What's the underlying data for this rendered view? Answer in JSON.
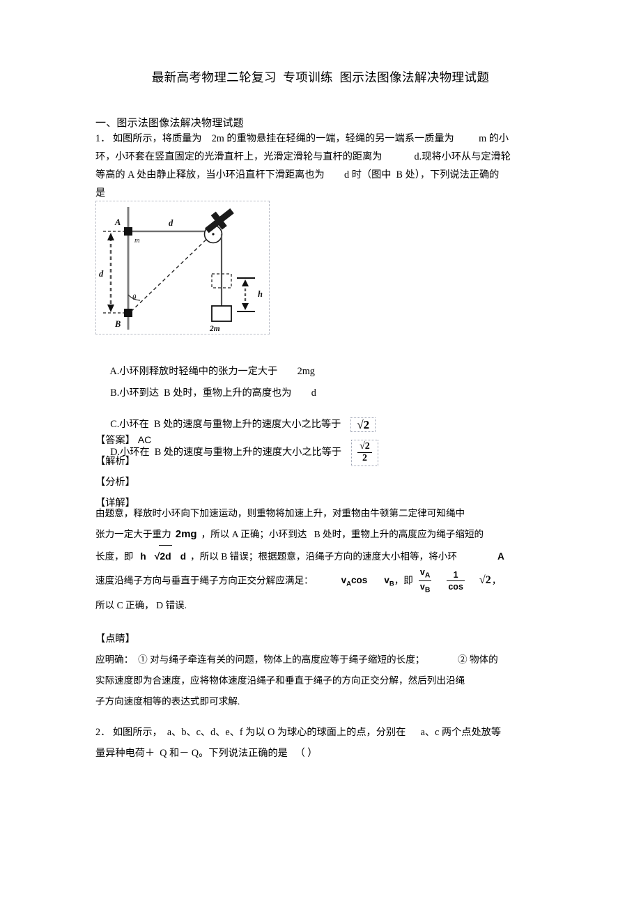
{
  "document": {
    "title": "最新高考物理二轮复习  专项训练  图示法图像法解决物理试题",
    "section_heading": "一、图示法图像法解决物理试题"
  },
  "question1": {
    "line1": "1． 如图所示，将质量为    2m 的重物悬挂在轻绳的一端，轻绳的另一端系一质量为          m 的小",
    "line2": "环，小环套在竖直固定的光滑直杆上，光滑定滑轮与直杆的距离为             d.现将小环从与定滑轮",
    "line3": "等高的 A 处由静止释放，当小环沿直杆下滑距离也为        d 时（图中  B 处），下列说法正确的",
    "line4": "是",
    "figure": {
      "label_A": "A",
      "label_B": "B",
      "label_m": "m",
      "label_2m": "2m",
      "label_d_horizontal": "d",
      "label_d_vertical": "d",
      "label_h": "h",
      "label_theta": "θ"
    },
    "options": [
      {
        "key": "A.",
        "text": "小环刚释放时轻绳中的张力一定大于        2mg"
      },
      {
        "key": "B.",
        "text": "小环到达  B 处时，重物上升的高度也为        d"
      },
      {
        "key": "C.",
        "text": "小环在  B 处的速度与重物上升的速度大小之比等于",
        "formula": "√2"
      },
      {
        "key": "D.",
        "text": "小环在  B 处的速度与重物上升的速度大小之比等于",
        "formula_num": "√2",
        "formula_den": "2"
      }
    ],
    "answer_label": "【答案】",
    "answer_value": "AC",
    "analysis_label": "【解析】",
    "fenxi_label": "【分析】",
    "xiangjie_label": "【详解】",
    "detail_line1": "由题意，释放时小环向下加速运动，则重物将加速上升，对重物由牛顿第二定律可知绳中",
    "detail_line2_a": "张力一定大于重力",
    "detail_line2_b": "2mg",
    "detail_line2_c": "，所以 A 正确；小环到达   B 处时，重物上升的高度应为绳子缩短的",
    "detail_line3_a": "长度，即",
    "detail_line3_h": "h",
    "detail_line3_sqrt": "2d",
    "detail_line3_d": "d",
    "detail_line3_b": "，所以 B 错误；根据题意，沿绳子方向的速度大小相等，将小环",
    "detail_line3_c": "A",
    "detail_line4_a": "速度沿绳子方向与垂直于绳子方向正交分解应满足：",
    "detail_line4_vacos": "cos",
    "detail_line4_vb": "，即",
    "detail_line4_comma": "，",
    "detail_line5": "所以 C 正确， D 错误.",
    "dianjing_label": "【点睛】",
    "dianjing_line1": "应明确：  ① 对与绳子牵连有关的问题，物体上的高度应等于绳子缩短的长度；              ② 物体的",
    "dianjing_line2": "实际速度即为合速度，应将物体速度沿绳子和垂直于绳子的方向正交分解，然后列出沿绳",
    "dianjing_line3": "子方向速度相等的表达式即可求解."
  },
  "question2": {
    "line1": "2． 如图所示，  a、b、c、d、e、f 为以 O 为球心的球面上的点，分别在      a、c 两个点处放等",
    "line2": "量异种电荷＋  Q 和－ Q。下列说法正确的是   （ ）"
  },
  "colors": {
    "text": "#000000",
    "figure_border": "#b9bcc6",
    "formula_border": "#9aa0b0",
    "rod": "#8a8a8a"
  }
}
